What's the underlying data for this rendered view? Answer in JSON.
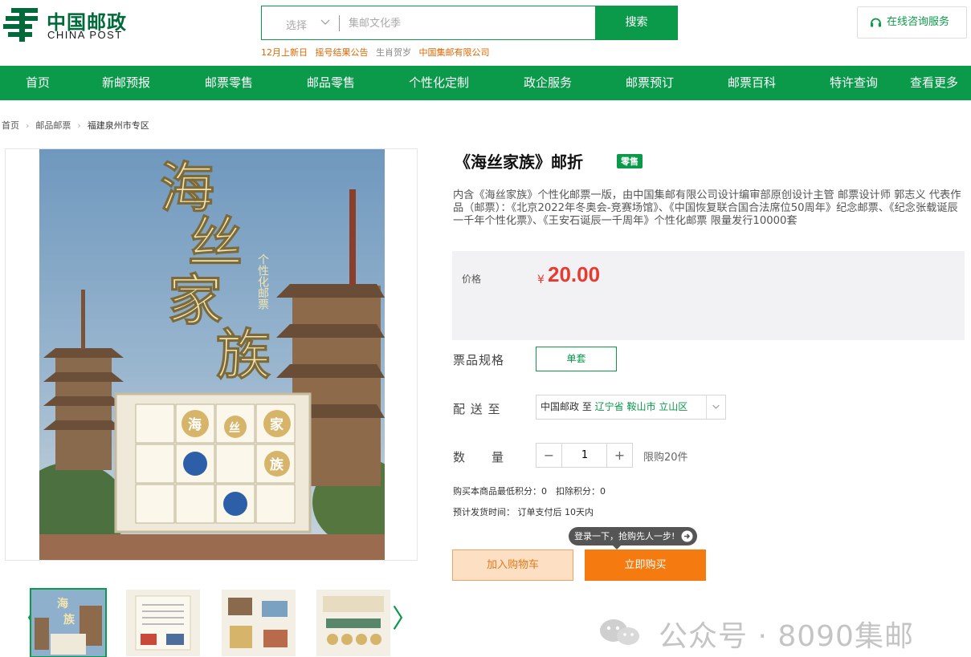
{
  "logo": {
    "cn": "中国邮政",
    "en": "CHINA POST"
  },
  "search": {
    "select_label": "选择",
    "placeholder": "集邮文化季",
    "button": "搜索"
  },
  "hotwords": [
    "12月上新日",
    "摇号结果公告",
    "生肖贺岁",
    "中国集邮有限公司"
  ],
  "consult": {
    "label": "在线咨询服务"
  },
  "nav": [
    "首页",
    "新邮预报",
    "邮票零售",
    "邮品零售",
    "个性化定制",
    "政企服务",
    "邮票预订",
    "邮票百科",
    "特许查询",
    "查看更多"
  ],
  "breadcrumb": [
    "首页",
    "邮品邮票",
    "福建泉州市专区"
  ],
  "main_image": {
    "title_chars": [
      "海",
      "丝",
      "家",
      "族"
    ],
    "subtitle": "个性化邮票",
    "sheet_chars": [
      "海",
      "丝",
      "家",
      "族"
    ]
  },
  "product": {
    "title": "《海丝家族》邮折",
    "badge": "零售",
    "description": "内含《海丝家族》个性化邮票一版，由中国集邮有限公司设计编审部原创设计主管 邮票设计师 郭志义 代表作品（邮票）：《北京2022年冬奥会-竞赛场馆》、《中国恢复联合国合法席位50周年》纪念邮票、《纪念张载诞辰一千年个性化票》、《王安石诞辰一千周年》个性化邮票 限量发行10000套",
    "price_label": "价格",
    "currency": "¥",
    "price": "20.00",
    "spec_label": "票品规格",
    "spec_value": "单套",
    "deliver_label": "配 送 至",
    "deliver_from": "中国邮政 至",
    "deliver_to": "辽宁省 鞍山市 立山区",
    "qty_label": "数　　量",
    "qty_minus": "−",
    "qty_value": "1",
    "qty_plus": "+",
    "limit": "限购20件",
    "points": "购买本商品最低积分：0　扣除积分：0",
    "ship_time": "预计发货时间：  订单支付后 10天内",
    "tip": "登录一下，抢购先人一步!",
    "cart_button": "加入购物车",
    "buy_button": "立即购买"
  },
  "thumb_arrows": {
    "prev": "〈",
    "next": "〉"
  },
  "watermark": "公众号 · 8090集邮",
  "colors": {
    "brand_green": "#0a9a4a",
    "price_red": "#e63b2e",
    "buy_orange": "#f57a10",
    "hotword_orange": "#e06500"
  }
}
